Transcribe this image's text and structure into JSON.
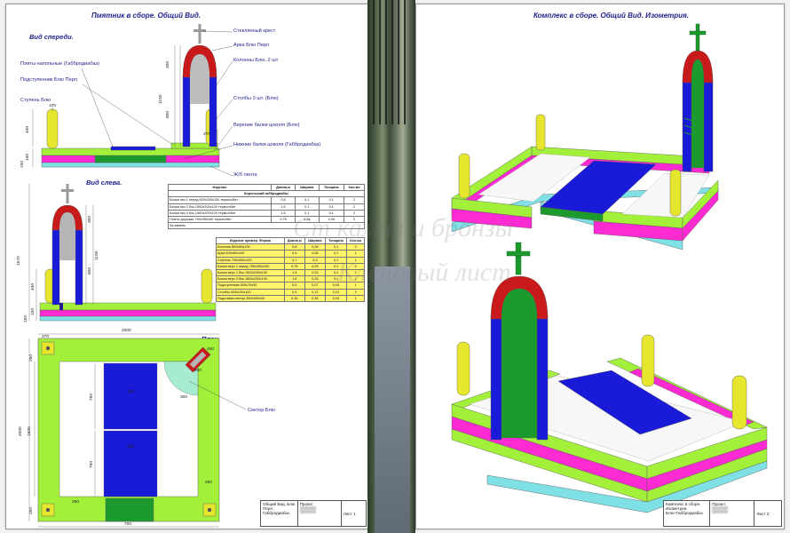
{
  "sheet1": {
    "title": "Пмятник в сборе. Общий Вид.",
    "front_view": {
      "title": "Вид спереди.",
      "labels": {
        "cross": "Стеклянный крест",
        "arch": "Арка Блю Перл",
        "columns": "Колонны Блю, 2 шт",
        "posts": "Столбы 3 шт. (Блю)",
        "upper_beam": "Верхние балки цоколя (Блю)",
        "lower_beam": "Нижние балки цоколя (Габбродиабаз)",
        "base_strip": "Ж/б лента",
        "floor_tiles": "Плиты напольные (Габбродиабаз)",
        "sub_stela": "Подступенник Блю Перл",
        "step": "Ступень Блю"
      },
      "dims": {
        "d300": "300",
        "d1100": "1100",
        "d800": "800",
        "d400": "400",
        "d270": "270",
        "d170": "170",
        "d100": "100",
        "d150": "150"
      }
    },
    "left_view": {
      "title": "Вид слева.",
      "dims": {
        "d1570": "1570",
        "d300": "300",
        "d1100": "1100",
        "d800": "800",
        "d400": "400",
        "d100": "100",
        "d150": "150"
      }
    },
    "plan_view": {
      "title": "План.",
      "sector_label": "Сектор Блю",
      "dims": {
        "d2000w": "2000",
        "d2000h": "2000",
        "d1500": "1500",
        "d270": "270",
        "d250a": "250",
        "d250b": "250",
        "d250c": "250",
        "d250d": "250",
        "d700": "700",
        "d750a": "750",
        "d750b": "750",
        "d350a": "350",
        "d350b": "350",
        "d300": "300",
        "d450": "450",
        "d800": "800"
      }
    },
    "spec_table": {
      "headers": [
        "Изделие",
        "Длина,м",
        "Ширина",
        "Толщина",
        "Кол-во"
      ],
      "group": "Корельский габбродиабаз",
      "rows": [
        [
          "Балка низ 1 перед 600x200x100 термо/сбит",
          "0,6",
          "0,1",
          "0,1",
          "2"
        ],
        [
          "Балка низ 2 бок 1500х200х100 термо/сбит",
          "1,5",
          "0,1",
          "0,1",
          "2"
        ],
        [
          "Балка низ 3 бок 1500х200х100 термо/сбит",
          "1,5",
          "0,1",
          "0,1",
          "2"
        ],
        [
          "Плиты дорожки 750х350х50 термо/сбит",
          "0,75",
          "0,35",
          "0,05",
          "2"
        ]
      ],
      "footer": "За камень"
    },
    "spec_table2": {
      "caption": "Изделие пример. Форма",
      "headers": [
        "Изделие пример. Форма",
        "Длина,м",
        "Ширина",
        "Толщина",
        "Кол-во"
      ],
      "rows": [
        [
          "Колонна 800х80х100",
          "0,8",
          "0,08",
          "0,1",
          "2"
        ],
        [
          "Арка 400х80х100",
          "0,4",
          "0,08",
          "0,1",
          "1"
        ],
        [
          "Ступень 700х300х100",
          "0,7",
          "0,3",
          "0,1",
          "1"
        ],
        [
          "Балка верх 1 перед 750х250х100",
          "0,75",
          "0,25",
          "0,1",
          "2"
        ],
        [
          "Балка верх 2 бок 1500х250х100",
          "1,5",
          "0,25",
          "0,1",
          "2"
        ],
        [
          "Балка верх 3 бок 1800х250х100",
          "1,8",
          "0,25",
          "0,1",
          "1"
        ],
        [
          "Подступенник 500х70х30",
          "0,5",
          "0,07",
          "0,03",
          "1"
        ],
        [
          "Столбы 400х120х120",
          "0,4",
          "0,12",
          "0,12",
          "3"
        ],
        [
          "Подставка сектор 350х350х30",
          "0,35",
          "0,35",
          "0,03",
          "1"
        ]
      ]
    },
    "title_block": {
      "name": "Общий Вид. Блю Перл. Габбродиабаз",
      "role": "Проект",
      "sheet": "Лист 1"
    }
  },
  "sheet2": {
    "title": "Комплекс в сборе. Общий Вид. Изометрия.",
    "title_block": {
      "name": "Комплекс в сборе. Изометрия. Блю+Габбродиабаз",
      "role": "Проект",
      "sheet": "Лист 2"
    }
  },
  "watermark": {
    "line1": "Ст  камня и бронзы",
    "line2": "Кленовый лист"
  },
  "colors": {
    "green": "#a3f03b",
    "magenta": "#ff2bd2",
    "cyan": "#7fe0e6",
    "blue": "#1a1ad9",
    "navy": "#1e1e8c",
    "yellow": "#e6e62e",
    "red": "#c81a1a",
    "darkgreen": "#1d9a2e",
    "gray": "#b5b5b5",
    "mint": "#a8ecd0"
  },
  "icons": {
    "cross": "cross-icon",
    "sector": "sector-icon"
  }
}
